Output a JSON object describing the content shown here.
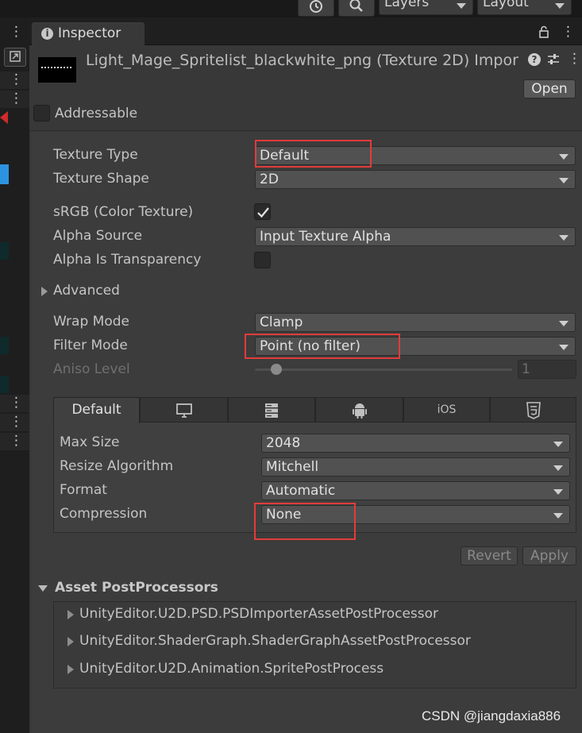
{
  "toolbar": {
    "layers_label": "Layers",
    "layout_label": "Layout"
  },
  "tab": {
    "title": "Inspector"
  },
  "header": {
    "asset_title": "Light_Mage_Spritelist_blackwhite_png (Texture 2D) Impor",
    "open_label": "Open"
  },
  "addressable": {
    "label": "Addressable",
    "checked": false
  },
  "fields": {
    "texture_type": {
      "label": "Texture Type",
      "value": "Default"
    },
    "texture_shape": {
      "label": "Texture Shape",
      "value": "2D"
    },
    "srgb": {
      "label": "sRGB (Color Texture)",
      "checked": true
    },
    "alpha_source": {
      "label": "Alpha Source",
      "value": "Input Texture Alpha"
    },
    "alpha_transparency": {
      "label": "Alpha Is Transparency",
      "checked": false
    },
    "advanced": {
      "label": "Advanced"
    },
    "wrap_mode": {
      "label": "Wrap Mode",
      "value": "Clamp"
    },
    "filter_mode": {
      "label": "Filter Mode",
      "value": "Point (no filter)"
    },
    "aniso_level": {
      "label": "Aniso Level",
      "value": "1"
    }
  },
  "platform": {
    "tabs": [
      {
        "name": "default",
        "label": "Default",
        "icon": ""
      },
      {
        "name": "standalone",
        "label": "",
        "icon": "monitor-icon"
      },
      {
        "name": "server",
        "label": "",
        "icon": "server-icon"
      },
      {
        "name": "android",
        "label": "",
        "icon": "android-icon"
      },
      {
        "name": "ios",
        "label": "iOS",
        "icon": ""
      },
      {
        "name": "webgl",
        "label": "",
        "icon": "html5-icon"
      }
    ],
    "max_size": {
      "label": "Max Size",
      "value": "2048"
    },
    "resize_algorithm": {
      "label": "Resize Algorithm",
      "value": "Mitchell"
    },
    "format": {
      "label": "Format",
      "value": "Automatic"
    },
    "compression": {
      "label": "Compression",
      "value": "None"
    }
  },
  "actions": {
    "revert_label": "Revert",
    "apply_label": "Apply"
  },
  "postprocessors": {
    "title": "Asset PostProcessors",
    "items": [
      "UnityEditor.U2D.PSD.PSDImporterAssetPostProcessor",
      "UnityEditor.ShaderGraph.ShaderGraphAssetPostProcessor",
      "UnityEditor.U2D.Animation.SpritePostProcess"
    ]
  },
  "watermark": "CSDN @jiangdaxia886",
  "colors": {
    "highlight": "#e33b3b",
    "selection": "#2c93e0",
    "panel": "#383838"
  }
}
